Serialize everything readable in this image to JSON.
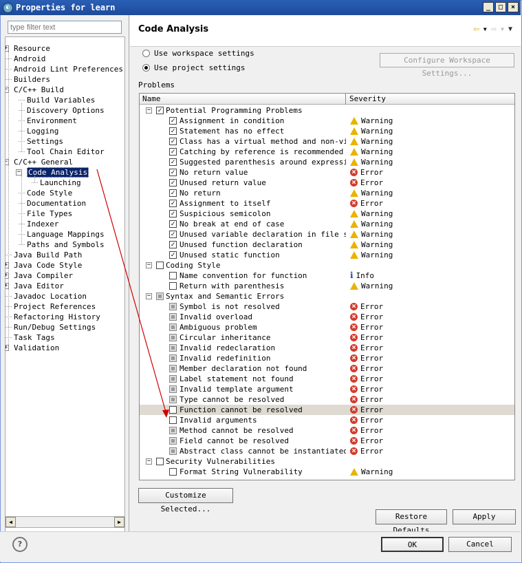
{
  "window": {
    "title": "Properties for learn"
  },
  "filter": {
    "placeholder": "type filter text"
  },
  "tree": [
    {
      "label": "Resource",
      "level": 0,
      "exp": "+"
    },
    {
      "label": "Android",
      "level": 0
    },
    {
      "label": "Android Lint Preferences",
      "level": 0
    },
    {
      "label": "Builders",
      "level": 0
    },
    {
      "label": "C/C++ Build",
      "level": 0,
      "exp": "-"
    },
    {
      "label": "Build Variables",
      "level": 1
    },
    {
      "label": "Discovery Options",
      "level": 1
    },
    {
      "label": "Environment",
      "level": 1
    },
    {
      "label": "Logging",
      "level": 1
    },
    {
      "label": "Settings",
      "level": 1
    },
    {
      "label": "Tool Chain Editor",
      "level": 1
    },
    {
      "label": "C/C++ General",
      "level": 0,
      "exp": "-"
    },
    {
      "label": "Code Analysis",
      "level": 1,
      "exp": "-",
      "selected": true
    },
    {
      "label": "Launching",
      "level": 2
    },
    {
      "label": "Code Style",
      "level": 1
    },
    {
      "label": "Documentation",
      "level": 1
    },
    {
      "label": "File Types",
      "level": 1
    },
    {
      "label": "Indexer",
      "level": 1
    },
    {
      "label": "Language Mappings",
      "level": 1
    },
    {
      "label": "Paths and Symbols",
      "level": 1
    },
    {
      "label": "Java Build Path",
      "level": 0
    },
    {
      "label": "Java Code Style",
      "level": 0,
      "exp": "+"
    },
    {
      "label": "Java Compiler",
      "level": 0,
      "exp": "+"
    },
    {
      "label": "Java Editor",
      "level": 0,
      "exp": "+"
    },
    {
      "label": "Javadoc Location",
      "level": 0
    },
    {
      "label": "Project References",
      "level": 0
    },
    {
      "label": "Refactoring History",
      "level": 0
    },
    {
      "label": "Run/Debug Settings",
      "level": 0
    },
    {
      "label": "Task Tags",
      "level": 0
    },
    {
      "label": "Validation",
      "level": 0,
      "exp": "+"
    }
  ],
  "page_title": "Code Analysis",
  "radio": {
    "workspace": "Use workspace settings",
    "project": "Use project settings",
    "selected": "project"
  },
  "configure_button": "Configure Workspace Settings...",
  "problems_label": "Problems",
  "columns": {
    "name": "Name",
    "severity": "Severity"
  },
  "rows": [
    {
      "cat": true,
      "name": "Potential Programming Problems",
      "check": "checked"
    },
    {
      "name": "Assignment in condition",
      "check": "checked",
      "sev": "Warning"
    },
    {
      "name": "Statement has no effect",
      "check": "checked",
      "sev": "Warning"
    },
    {
      "name": "Class has a virtual method and non-virtual destructor",
      "check": "checked",
      "sev": "Warning"
    },
    {
      "name": "Catching by reference is recommended",
      "check": "checked",
      "sev": "Warning"
    },
    {
      "name": "Suggested parenthesis around expression",
      "check": "checked",
      "sev": "Warning"
    },
    {
      "name": "No return value",
      "check": "checked",
      "sev": "Error"
    },
    {
      "name": "Unused return value",
      "check": "checked",
      "sev": "Error"
    },
    {
      "name": "No return",
      "check": "checked",
      "sev": "Warning"
    },
    {
      "name": "Assignment to itself",
      "check": "checked",
      "sev": "Error"
    },
    {
      "name": "Suspicious semicolon",
      "check": "checked",
      "sev": "Warning"
    },
    {
      "name": "No break at end of case",
      "check": "checked",
      "sev": "Warning"
    },
    {
      "name": "Unused variable declaration in file scope",
      "check": "checked",
      "sev": "Warning"
    },
    {
      "name": "Unused function declaration",
      "check": "checked",
      "sev": "Warning"
    },
    {
      "name": "Unused static function",
      "check": "checked",
      "sev": "Warning"
    },
    {
      "cat": true,
      "name": "Coding Style",
      "check": "none"
    },
    {
      "name": "Name convention for function",
      "check": "none",
      "sev": "Info"
    },
    {
      "name": "Return with parenthesis",
      "check": "none",
      "sev": "Warning"
    },
    {
      "cat": true,
      "name": "Syntax and Semantic Errors",
      "check": "gray"
    },
    {
      "name": "Symbol is not resolved",
      "check": "gray",
      "sev": "Error"
    },
    {
      "name": "Invalid overload",
      "check": "gray",
      "sev": "Error"
    },
    {
      "name": "Ambiguous problem",
      "check": "gray",
      "sev": "Error"
    },
    {
      "name": "Circular inheritance",
      "check": "gray",
      "sev": "Error"
    },
    {
      "name": "Invalid redeclaration",
      "check": "gray",
      "sev": "Error"
    },
    {
      "name": "Invalid redefinition",
      "check": "gray",
      "sev": "Error"
    },
    {
      "name": "Member declaration not found",
      "check": "gray",
      "sev": "Error"
    },
    {
      "name": "Label statement not found",
      "check": "gray",
      "sev": "Error"
    },
    {
      "name": "Invalid template argument",
      "check": "gray",
      "sev": "Error"
    },
    {
      "name": "Type cannot be resolved",
      "check": "gray",
      "sev": "Error"
    },
    {
      "name": "Function cannot be resolved",
      "check": "none",
      "sev": "Error",
      "hl": true
    },
    {
      "name": "Invalid arguments",
      "check": "none",
      "sev": "Error"
    },
    {
      "name": "Method cannot be resolved",
      "check": "gray",
      "sev": "Error"
    },
    {
      "name": "Field cannot be resolved",
      "check": "gray",
      "sev": "Error"
    },
    {
      "name": "Abstract class cannot be instantiated",
      "check": "gray",
      "sev": "Error"
    },
    {
      "cat": true,
      "name": "Security Vulnerabilities",
      "check": "none"
    },
    {
      "name": "Format String Vulnerability",
      "check": "none",
      "sev": "Warning"
    }
  ],
  "buttons": {
    "customize": "Customize Selected...",
    "restore": "Restore Defaults",
    "apply": "Apply",
    "ok": "OK",
    "cancel": "Cancel"
  },
  "colors": {
    "selection": "#0a246a",
    "warning": "#e8b400",
    "error": "#d43b2b",
    "arrow": "#d00000"
  }
}
